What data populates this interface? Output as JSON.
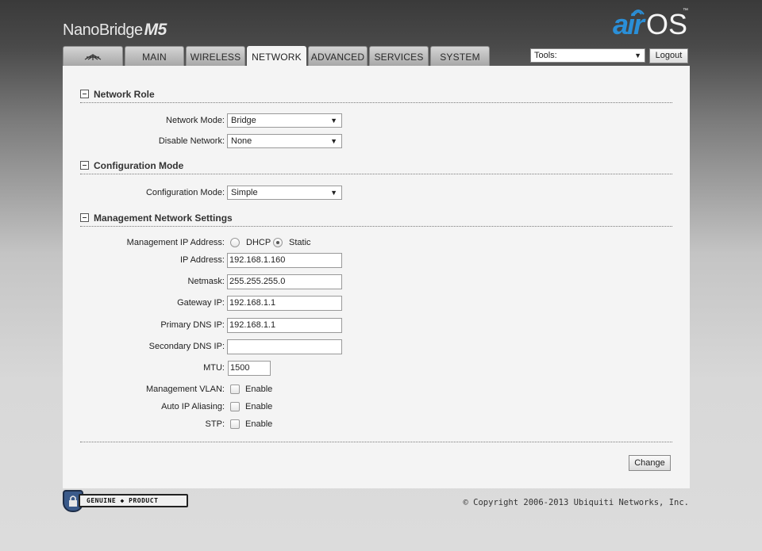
{
  "header": {
    "device_name": "NanoBridge",
    "device_model": "M5",
    "logo_air": "air",
    "logo_os": "OS",
    "logo_tm": "™"
  },
  "tabs": [
    {
      "label": "",
      "icon": "ubiquiti-logo-icon",
      "active": false
    },
    {
      "label": "MAIN",
      "active": false
    },
    {
      "label": "WIRELESS",
      "active": false
    },
    {
      "label": "NETWORK",
      "active": true
    },
    {
      "label": "ADVANCED",
      "active": false
    },
    {
      "label": "SERVICES",
      "active": false
    },
    {
      "label": "SYSTEM",
      "active": false
    }
  ],
  "toolbar": {
    "tools_value": "Tools:",
    "logout_label": "Logout"
  },
  "network_role": {
    "title": "Network Role",
    "network_mode_label": "Network Mode:",
    "network_mode_value": "Bridge",
    "disable_network_label": "Disable Network:",
    "disable_network_value": "None"
  },
  "configuration_mode": {
    "title": "Configuration Mode",
    "config_mode_label": "Configuration Mode:",
    "config_mode_value": "Simple"
  },
  "management": {
    "title": "Management Network Settings",
    "mgmt_ip_label": "Management IP Address:",
    "dhcp_label": "DHCP",
    "static_label": "Static",
    "selected": "Static",
    "ip_label": "IP Address:",
    "ip_value": "192.168.1.160",
    "netmask_label": "Netmask:",
    "netmask_value": "255.255.255.0",
    "gateway_label": "Gateway IP:",
    "gateway_value": "192.168.1.1",
    "primary_dns_label": "Primary DNS IP:",
    "primary_dns_value": "192.168.1.1",
    "secondary_dns_label": "Secondary DNS IP:",
    "secondary_dns_value": "",
    "mtu_label": "MTU:",
    "mtu_value": "1500",
    "vlan_label": "Management VLAN:",
    "vlan_enable": "Enable",
    "vlan_checked": false,
    "aliasing_label": "Auto IP Aliasing:",
    "aliasing_enable": "Enable",
    "aliasing_checked": false,
    "stp_label": "STP:",
    "stp_enable": "Enable",
    "stp_checked": false
  },
  "actions": {
    "change_label": "Change"
  },
  "footer": {
    "badge_text": "GENUINE ◆ PRODUCT",
    "copyright": "© Copyright 2006-2013 Ubiquiti Networks, Inc."
  },
  "colors": {
    "accent_blue": "#2a8fd8",
    "panel_bg": "#f4f4f4"
  }
}
